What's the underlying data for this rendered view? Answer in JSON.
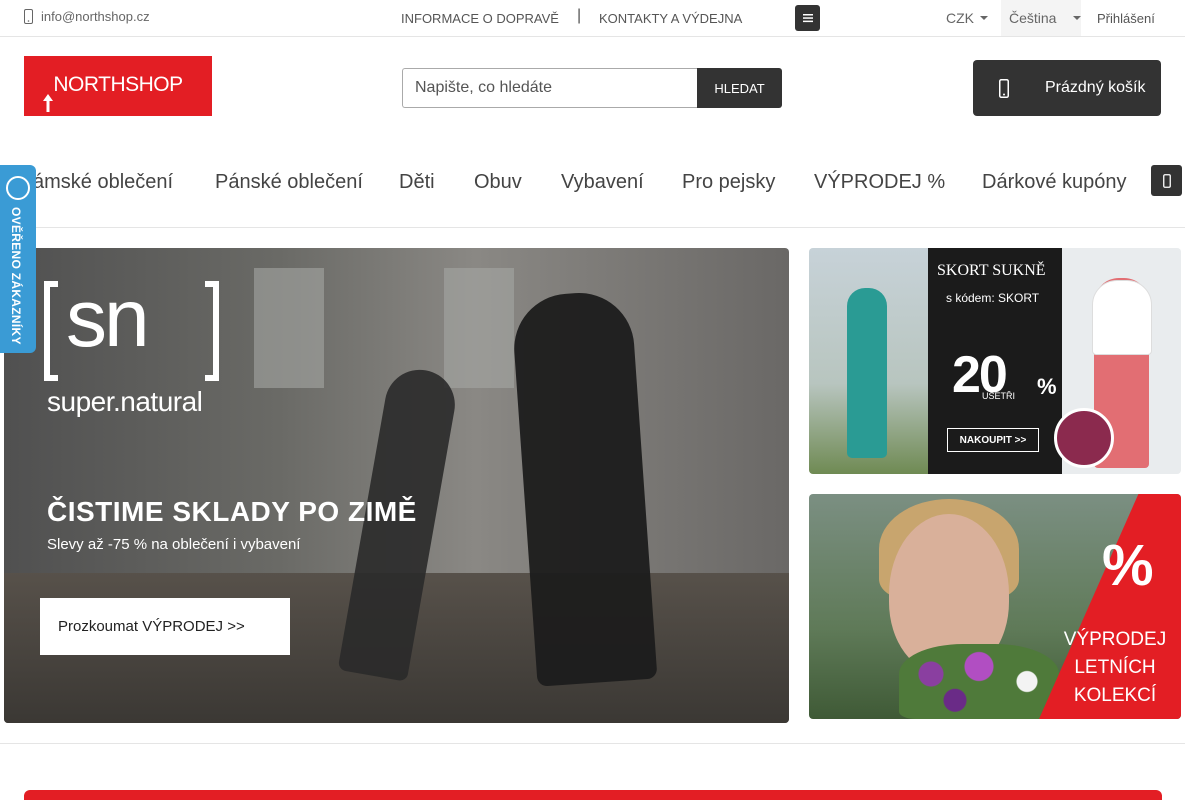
{
  "topbar": {
    "email": "info@northshop.cz",
    "links": [
      "INFORMACE O DOPRAVĚ",
      "KONTAKTY A VÝDEJNA"
    ],
    "separator": "|",
    "currency": "CZK",
    "language": "Čeština",
    "login": "Přihlášení"
  },
  "header": {
    "logo_text": "NORTHSHOP",
    "search_placeholder": "Napište, co hledáte",
    "search_button": "HLEDAT",
    "cart_label": "Prázdný košík"
  },
  "nav": {
    "items": [
      "ámské oblečení",
      "Pánské oblečení",
      "Děti",
      "Obuv",
      "Vybavení",
      "Pro pejsky",
      "VÝPRODEJ %",
      "Dárkové kupóny"
    ]
  },
  "badge": {
    "text": "OVĚŘENO ZÁKAZNÍKY"
  },
  "banners": {
    "main": {
      "brand_sn": "sn",
      "brand": "super.natural",
      "headline": "ČISTIME SKLADY PO ZIMĚ",
      "sub": "Slevy až -75 % na oblečení i vybavení",
      "cta": "Prozkoumat VÝPRODEJ >>"
    },
    "skort": {
      "title": "SKORT SUKNĚ",
      "code": "s kódem: SKORT",
      "save": "UŠETŘI",
      "value": "20",
      "unit": "%",
      "button": "NAKOUPIT >>"
    },
    "summer": {
      "percent": "%",
      "lines": [
        "VÝPRODEJ",
        "LETNÍCH",
        "KOLEKCÍ"
      ]
    }
  },
  "colors": {
    "brand_red": "#e31e24",
    "dark": "#333333",
    "badge_blue": "#3a9bd5"
  }
}
